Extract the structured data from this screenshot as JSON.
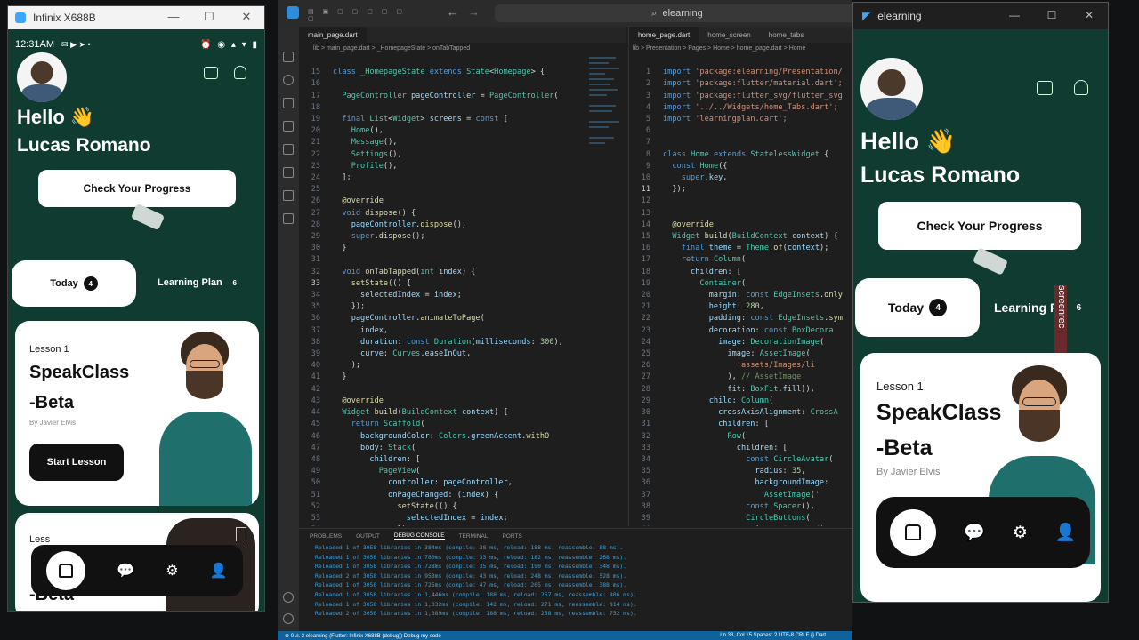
{
  "phone_window": {
    "title": "Infinix X688B",
    "status_time": "12:31AM",
    "status_icons": "⏰ ◉ ▴ ▾ ▮"
  },
  "app_window": {
    "title": "elearning"
  },
  "flutter_app": {
    "greeting": "Hello 👋",
    "user_name": "Lucas Romano",
    "progress_button": "Check Your Progress",
    "tabs": [
      {
        "label": "Today",
        "count": "4"
      },
      {
        "label": "Learning Plan",
        "count": "6"
      }
    ],
    "right_tab2_label": "Learning P",
    "lesson_card": {
      "number": "Lesson 1",
      "title_line1": "SpeakClass",
      "title_line2": "-Beta",
      "author": "By Javier Elvis",
      "start_button": "Start Lesson"
    },
    "peek_title": "-Beta",
    "peek_num": "Less"
  },
  "vscode": {
    "search_text": "elearning",
    "left_tab": "main_page.dart",
    "right_tabs": [
      "home_page.dart",
      "home_screen",
      "home_tabs"
    ],
    "left_breadcrumb": "lib > main_page.dart > _HomepageState > onTabTapped",
    "right_breadcrumb": "lib > Presentation > Pages > Home > home_page.dart > Home",
    "terminal_tabs": [
      "PROBLEMS",
      "OUTPUT",
      "DEBUG CONSOLE",
      "TERMINAL",
      "PORTS"
    ],
    "terminal_lines": [
      "Reloaded 1 of 3058 libraries in 384ms (compile: 38 ms, reload: 188 ms, reassemble: 88 ms).",
      "Reloaded 1 of 3058 libraries in 780ms (compile: 33 ms, reload: 182 ms, reassemble: 268 ms).",
      "Reloaded 1 of 3058 libraries in 728ms (compile: 35 ms, reload: 190 ms, reassemble: 348 ms).",
      "Reloaded 2 of 3058 libraries in 953ms (compile: 43 ms, reload: 248 ms, reassemble: 528 ms).",
      "Reloaded 1 of 3058 libraries in 725ms (compile: 47 ms, reload: 205 ms, reassemble: 388 ms).",
      "Reloaded 1 of 3058 libraries in 1,446ms (compile: 188 ms, reload: 257 ms, reassemble: 806 ms).",
      "Reloaded 1 of 3058 libraries in 1,332ms (compile: 142 ms, reload: 271 ms, reassemble: 814 ms).",
      "Reloaded 2 of 3058 libraries in 1,389ms (compile: 188 ms, reload: 258 ms, reassemble: 752 ms)."
    ],
    "status_left": "⊗ 0 ⚠ 3   elearning (Flutter: Infinix X688B (debug))   Debug my code",
    "status_right": "Ln 33, Col 15   Spaces: 2   UTF-8   CRLF   {} Dart"
  }
}
